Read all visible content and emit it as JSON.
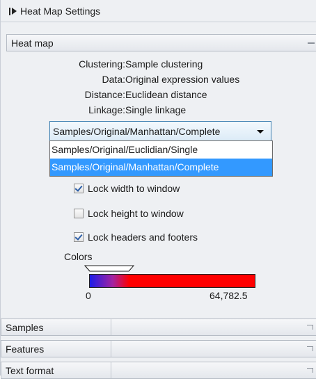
{
  "panel": {
    "title": "Heat Map Settings"
  },
  "heatmap_section": {
    "label": "Heat map",
    "info": [
      {
        "key": "Clustering:",
        "value": "Sample clustering"
      },
      {
        "key": "Data:",
        "value": "Original expression values"
      },
      {
        "key": "Distance:",
        "value": "Euclidean distance"
      },
      {
        "key": "Linkage:",
        "value": "Single linkage"
      }
    ],
    "combo": {
      "selected": "Samples/Original/Manhattan/Complete",
      "options": [
        "Samples/Original/Euclidian/Single",
        "Samples/Original/Manhattan/Complete"
      ],
      "highlighted_index": 1
    },
    "checkboxes": [
      {
        "label": "Lock width to window",
        "checked": true
      },
      {
        "label": "Lock height to window",
        "checked": false
      },
      {
        "label": "Lock headers and footers",
        "checked": true
      }
    ],
    "colors": {
      "label": "Colors",
      "min_label": "0",
      "max_label": "64,782.5",
      "gradient_colors": [
        "#1d1de8",
        "#a423a0",
        "#ff0000"
      ]
    }
  },
  "sections": [
    {
      "label": "Samples"
    },
    {
      "label": "Features"
    },
    {
      "label": "Text format"
    }
  ]
}
